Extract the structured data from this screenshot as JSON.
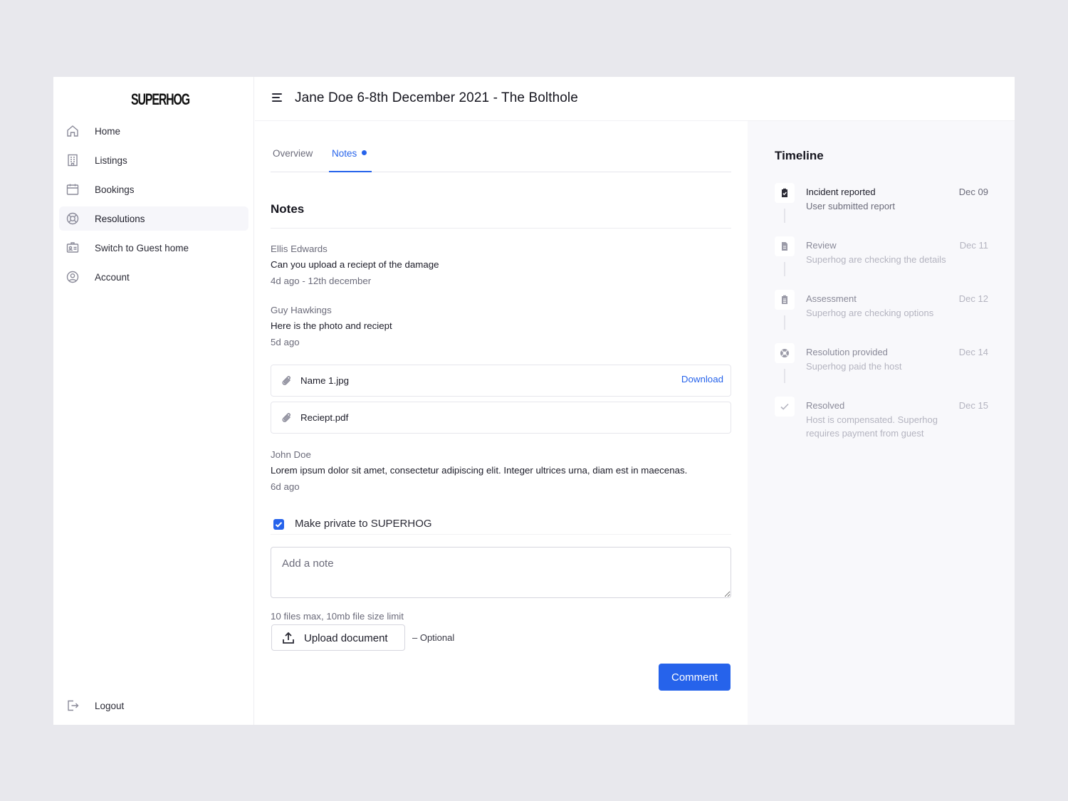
{
  "brand": {
    "logo": "SUPERHOG"
  },
  "sidebar": {
    "items": [
      {
        "label": "Home",
        "icon": "home-icon"
      },
      {
        "label": "Listings",
        "icon": "building-icon"
      },
      {
        "label": "Bookings",
        "icon": "calendar-icon"
      },
      {
        "label": "Resolutions",
        "icon": "lifebuoy-icon",
        "active": true
      },
      {
        "label": "Switch to Guest home",
        "icon": "id-card-icon"
      },
      {
        "label": "Account",
        "icon": "user-circle-icon"
      }
    ],
    "logout_label": "Logout"
  },
  "header": {
    "title": "Jane Doe 6-8th December 2021 - The Bolthole"
  },
  "tabs": [
    {
      "label": "Overview"
    },
    {
      "label": "Notes",
      "active": true
    }
  ],
  "notes_section": {
    "title": "Notes",
    "notes": [
      {
        "author": "Ellis Edwards",
        "body": "Can you upload a reciept of the damage",
        "time": "4d ago - 12th december"
      },
      {
        "author": "Guy Hawkings",
        "body": "Here is the photo and reciept",
        "time": "5d ago"
      },
      {
        "author": "John Doe",
        "body": "Lorem ipsum dolor sit amet, consectetur adipiscing elit. Integer ultrices urna, diam est in maecenas.",
        "time": "6d ago"
      }
    ],
    "attachments": [
      {
        "name": "Name 1.jpg",
        "action": "Download"
      },
      {
        "name": "Reciept.pdf"
      }
    ]
  },
  "composer": {
    "private_label": "Make private to SUPERHOG",
    "private_checked": true,
    "placeholder": "Add a note",
    "limit_text": "10 files max, 10mb file size limit",
    "upload_label": "Upload document",
    "optional_label": "– Optional",
    "submit_label": "Comment"
  },
  "timeline": {
    "title": "Timeline",
    "items": [
      {
        "name": "Incident reported",
        "desc": "User submitted report",
        "date": "Dec 09",
        "status": "done",
        "icon": "clipboard-check-icon"
      },
      {
        "name": "Review",
        "desc": "Superhog are checking the details",
        "date": "Dec 11",
        "status": "pending",
        "icon": "document-icon"
      },
      {
        "name": "Assessment",
        "desc": "Superhog are checking options",
        "date": "Dec 12",
        "status": "pending",
        "icon": "clipboard-icon"
      },
      {
        "name": "Resolution provided",
        "desc": "Superhog paid the host",
        "date": "Dec 14",
        "status": "pending",
        "icon": "lifebuoy-icon"
      },
      {
        "name": "Resolved",
        "desc": "Host is compensated. Superhog requires payment from guest",
        "date": "Dec 15",
        "status": "pending",
        "icon": "check-icon"
      }
    ]
  },
  "colors": {
    "accent": "#2663eb",
    "background": "#e8e8ed",
    "timeline_bg": "#f8f8fb"
  }
}
